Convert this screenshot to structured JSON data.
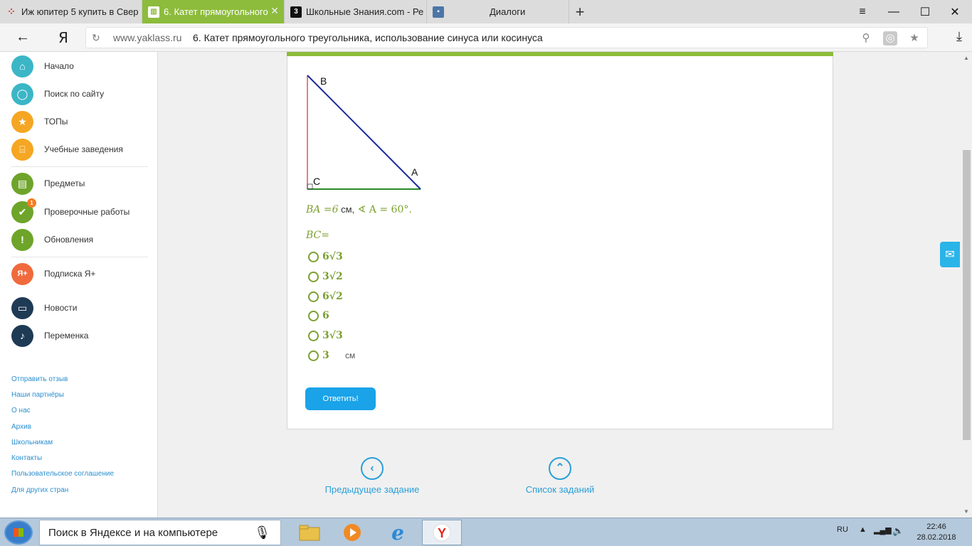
{
  "browser": {
    "tabs": [
      {
        "label": "Иж юпитер 5 купить в Свер",
        "icon": "dots-icon",
        "active": false
      },
      {
        "label": "6. Катет прямоугольного",
        "icon": "book-icon",
        "active": true
      },
      {
        "label": "Школьные Знания.com - Ре",
        "icon": "znania-icon",
        "active": false
      },
      {
        "label": "Диалоги",
        "icon": "chat-icon",
        "active": false
      }
    ],
    "new_tab": "+",
    "window_controls": {
      "menu": "≡",
      "minimize": "—",
      "maximize": "☐",
      "close": "✕"
    },
    "back": "←",
    "logo": "Я",
    "domain": "www.yaklass.ru",
    "page_title": "6. Катет прямоугольного треугольника, использование синуса или косинуса"
  },
  "sidebar": {
    "nav": [
      {
        "label": "Начало",
        "icon": "home-icon",
        "color": "#3bb6c6",
        "glyph": "⌂"
      },
      {
        "label": "Поиск по сайту",
        "icon": "search-icon",
        "color": "#3bb6c6",
        "glyph": "⚲"
      },
      {
        "label": "ТОПы",
        "icon": "star-icon",
        "color": "#f5a623",
        "glyph": "★"
      },
      {
        "label": "Учебные заведения",
        "icon": "institution-icon",
        "color": "#f5a623",
        "glyph": "⌸"
      },
      {
        "label": "Предметы",
        "icon": "book-icon",
        "color": "#6ea42a",
        "glyph": "▤"
      },
      {
        "label": "Проверочные работы",
        "icon": "check-icon",
        "color": "#6ea42a",
        "glyph": "✔",
        "badge": "1"
      },
      {
        "label": "Обновления",
        "icon": "exclamation-icon",
        "color": "#6ea42a",
        "glyph": "!"
      },
      {
        "label": "Подписка Я+",
        "icon": "yaplus-icon",
        "color": "#f06a3c",
        "glyph": "Я+"
      },
      {
        "label": "Новости",
        "icon": "news-icon",
        "color": "#1e3a55",
        "glyph": "▭"
      },
      {
        "label": "Переменка",
        "icon": "bell-icon",
        "color": "#1e3a55",
        "glyph": "♪"
      }
    ],
    "footer_links": [
      "Отправить отзыв",
      "Наши партнёры",
      "О нас",
      "Архив",
      "Школьникам",
      "Контакты",
      "Пользовательское соглашение",
      "Для других стран"
    ]
  },
  "exercise": {
    "diagram": {
      "vertex_b": "B",
      "vertex_a": "A",
      "vertex_c": "C"
    },
    "condition": {
      "part1": "BA =6",
      "unit1": " см,",
      "part2": " ∢ A = 60°."
    },
    "question": "BC=",
    "options": [
      "6√3",
      "3√2",
      "6√2",
      "6",
      "3√3",
      "3"
    ],
    "unit": "см",
    "submit_label": "Ответить!"
  },
  "bottom_nav": {
    "prev_label": "Предыдущее задание",
    "list_label": "Список заданий"
  },
  "taskbar": {
    "search_text": "Поиск в Яндексе и на компьютере",
    "lang": "RU",
    "time": "22:46",
    "date": "28.02.2018"
  }
}
